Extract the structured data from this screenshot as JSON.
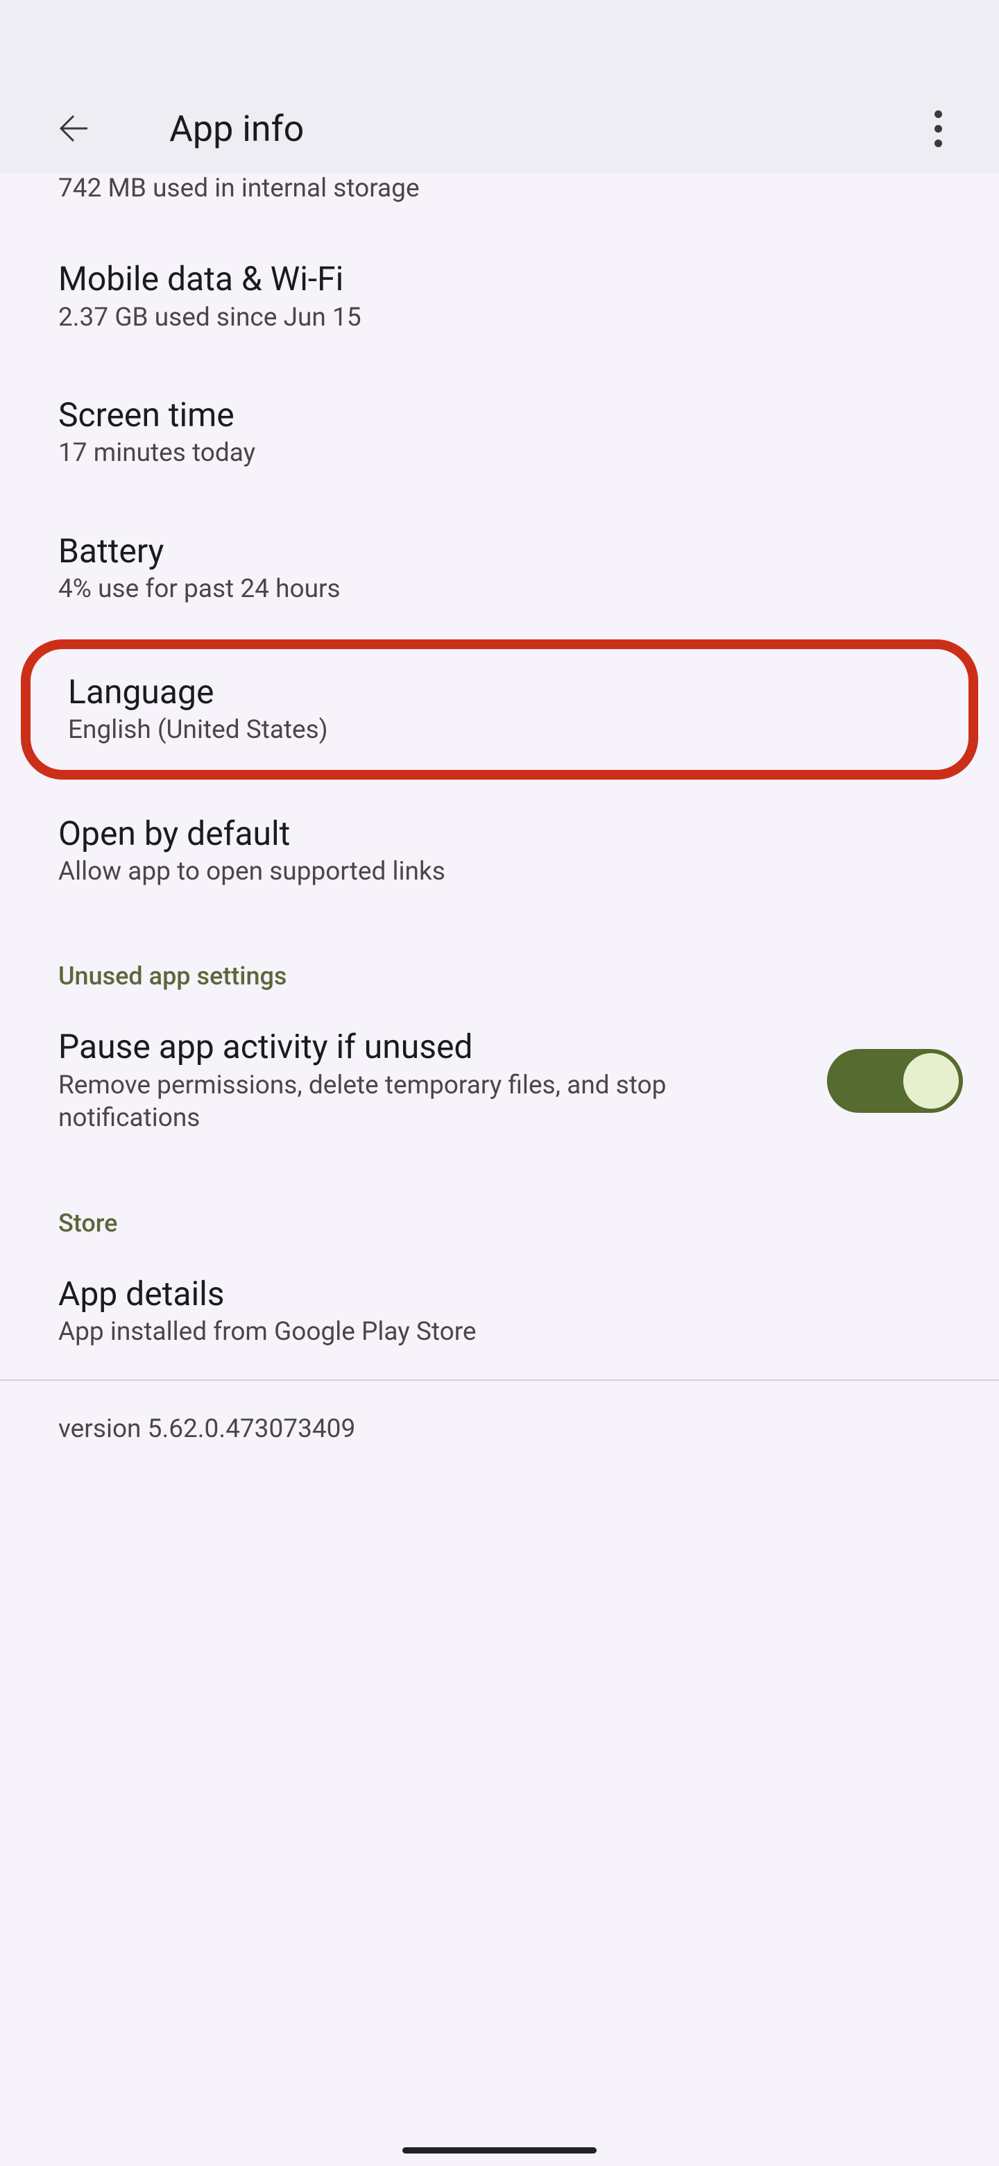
{
  "header": {
    "title": "App info"
  },
  "top_partial_sub": "742 MB used in internal storage",
  "items": {
    "mobile_data": {
      "title": "Mobile data & Wi-Fi",
      "sub": "2.37 GB used since Jun 15"
    },
    "screen_time": {
      "title": "Screen time",
      "sub": "17 minutes today"
    },
    "battery": {
      "title": "Battery",
      "sub": "4% use for past 24 hours"
    },
    "language": {
      "title": "Language",
      "sub": "English (United States)"
    },
    "open_default": {
      "title": "Open by default",
      "sub": "Allow app to open supported links"
    }
  },
  "sections": {
    "unused": {
      "header": "Unused app settings",
      "pause": {
        "title": "Pause app activity if unused",
        "sub": "Remove permissions, delete temporary files, and stop notifications",
        "enabled": true
      }
    },
    "store": {
      "header": "Store",
      "details": {
        "title": "App details",
        "sub": "App installed from Google Play Store"
      }
    }
  },
  "version": "version 5.62.0.473073409"
}
